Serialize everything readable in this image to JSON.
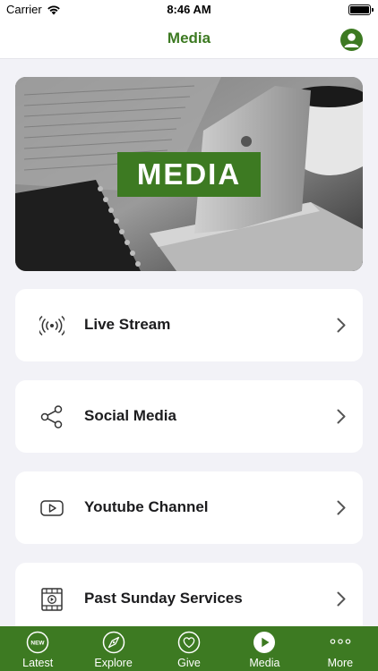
{
  "status_bar": {
    "carrier": "Carrier",
    "time": "8:46 AM"
  },
  "nav": {
    "title": "Media"
  },
  "hero": {
    "label": "MEDIA"
  },
  "menu": [
    {
      "label": "Live Stream",
      "icon": "live-stream-icon"
    },
    {
      "label": "Social Media",
      "icon": "share-icon"
    },
    {
      "label": "Youtube Channel",
      "icon": "youtube-icon"
    },
    {
      "label": "Past Sunday Services",
      "icon": "video-file-icon"
    }
  ],
  "tabs": [
    {
      "label": "Latest",
      "icon": "new-badge-icon",
      "badge": "NEW"
    },
    {
      "label": "Explore",
      "icon": "compass-icon"
    },
    {
      "label": "Give",
      "icon": "heart-icon"
    },
    {
      "label": "Media",
      "icon": "play-icon",
      "active": true
    },
    {
      "label": "More",
      "icon": "more-dots-icon"
    }
  ],
  "colors": {
    "accent": "#3d7a22",
    "background": "#f2f2f7",
    "card": "#ffffff"
  }
}
